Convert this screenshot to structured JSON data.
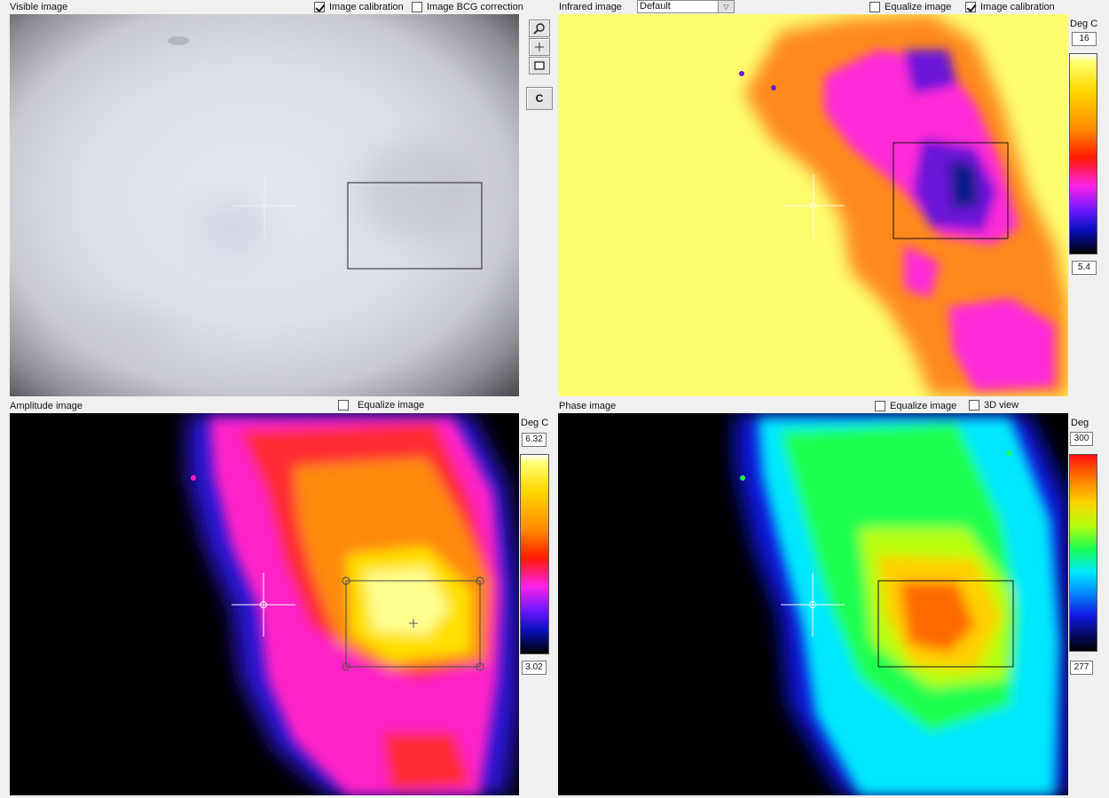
{
  "visible": {
    "title": "Visible image",
    "calibration_label": "Image calibration",
    "calibration_checked": true,
    "bcg_label": "Image BCG correction",
    "bcg_checked": false
  },
  "infrared": {
    "title": "Infrared image",
    "palette_value": "Default",
    "equalize_label": "Equalize image",
    "equalize_checked": false,
    "calibration_label": "Image calibration",
    "calibration_checked": true,
    "unit": "Deg C",
    "max": "16",
    "min": "5.4"
  },
  "tools": {
    "zoom_icon": "magnifier-icon",
    "crosshair_icon": "crosshair-icon",
    "rect_icon": "rectangle-icon",
    "clear_label": "C"
  },
  "amplitude": {
    "title": "Amplitude image",
    "equalize_label": "Equalize image",
    "equalize_checked": false,
    "unit": "Deg C",
    "max": "6.32",
    "min": "3.02"
  },
  "phase": {
    "title": "Phase image",
    "equalize_label": "Equalize image",
    "equalize_checked": false,
    "view3d_label": "3D view",
    "view3d_checked": false,
    "unit": "Deg",
    "max": "300",
    "min": "277"
  },
  "colors": {
    "window_bg": "#f0f0f0",
    "ir_background": "#fdfd6e",
    "thermal_blue": "#0a1a8a",
    "thermal_magenta": "#ff20d0",
    "thermal_orange": "#ff8a00"
  }
}
